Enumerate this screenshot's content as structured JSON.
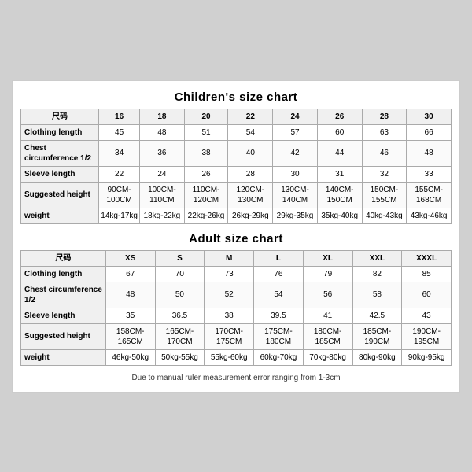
{
  "children_chart": {
    "title": "Children's size chart",
    "headers": [
      "尺码",
      "16",
      "18",
      "20",
      "22",
      "24",
      "26",
      "28",
      "30"
    ],
    "rows": [
      {
        "label": "Clothing length",
        "values": [
          "45",
          "48",
          "51",
          "54",
          "57",
          "60",
          "63",
          "66"
        ]
      },
      {
        "label": "Chest circumference 1/2",
        "values": [
          "34",
          "36",
          "38",
          "40",
          "42",
          "44",
          "46",
          "48"
        ]
      },
      {
        "label": "Sleeve length",
        "values": [
          "22",
          "24",
          "26",
          "28",
          "30",
          "31",
          "32",
          "33"
        ]
      },
      {
        "label": "Suggested height",
        "values": [
          "90CM-100CM",
          "100CM-110CM",
          "110CM-120CM",
          "120CM-130CM",
          "130CM-140CM",
          "140CM-150CM",
          "150CM-155CM",
          "155CM-168CM"
        ]
      },
      {
        "label": "weight",
        "values": [
          "14kg-17kg",
          "18kg-22kg",
          "22kg-26kg",
          "26kg-29kg",
          "29kg-35kg",
          "35kg-40kg",
          "40kg-43kg",
          "43kg-46kg"
        ]
      }
    ]
  },
  "adult_chart": {
    "title": "Adult size chart",
    "headers": [
      "尺码",
      "XS",
      "S",
      "M",
      "L",
      "XL",
      "XXL",
      "XXXL"
    ],
    "rows": [
      {
        "label": "Clothing length",
        "values": [
          "67",
          "70",
          "73",
          "76",
          "79",
          "82",
          "85"
        ]
      },
      {
        "label": "Chest circumference 1/2",
        "values": [
          "48",
          "50",
          "52",
          "54",
          "56",
          "58",
          "60"
        ]
      },
      {
        "label": "Sleeve length",
        "values": [
          "35",
          "36.5",
          "38",
          "39.5",
          "41",
          "42.5",
          "43"
        ]
      },
      {
        "label": "Suggested height",
        "values": [
          "158CM-165CM",
          "165CM-170CM",
          "170CM-175CM",
          "175CM-180CM",
          "180CM-185CM",
          "185CM-190CM",
          "190CM-195CM"
        ]
      },
      {
        "label": "weight",
        "values": [
          "46kg-50kg",
          "50kg-55kg",
          "55kg-60kg",
          "60kg-70kg",
          "70kg-80kg",
          "80kg-90kg",
          "90kg-95kg"
        ]
      }
    ]
  },
  "note": "Due to manual ruler measurement error ranging from 1-3cm"
}
